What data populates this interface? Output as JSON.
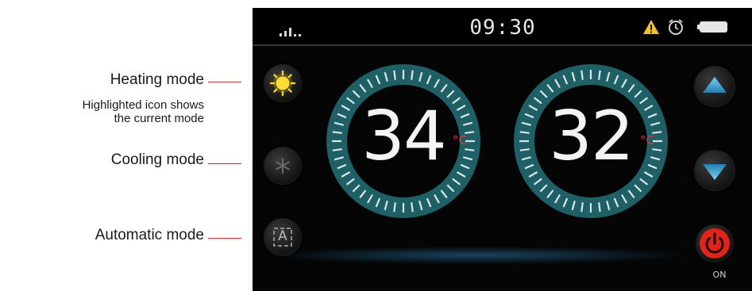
{
  "annotations": {
    "heating_label": "Heating mode",
    "heating_note_line1": "Highlighted icon shows",
    "heating_note_line2": "the current mode",
    "cooling_label": "Cooling mode",
    "automatic_label": "Automatic mode"
  },
  "status_bar": {
    "time": "09:30",
    "icons": [
      "signal-icon",
      "warning-icon",
      "alarm-clock-icon",
      "battery-icon"
    ]
  },
  "mode_buttons": {
    "heating": {
      "icon": "sun-icon",
      "active": true
    },
    "cooling": {
      "icon": "snowflake-icon",
      "active": false
    },
    "automatic": {
      "icon": "auto-icon",
      "label": "A",
      "active": false
    }
  },
  "dials": [
    {
      "value": "34",
      "unit": "°C"
    },
    {
      "value": "32",
      "unit": "°C"
    }
  ],
  "controls": {
    "up": {
      "icon": "arrow-up-icon"
    },
    "down": {
      "icon": "arrow-down-icon"
    },
    "power": {
      "icon": "power-icon",
      "label": "ON"
    }
  },
  "colors": {
    "accent_red": "#d21a26",
    "dial_ring": "#1f5f66",
    "arrow_blue": "#3aa8d8",
    "sun_yellow": "#ffd21e",
    "power_red": "#e2231a"
  }
}
